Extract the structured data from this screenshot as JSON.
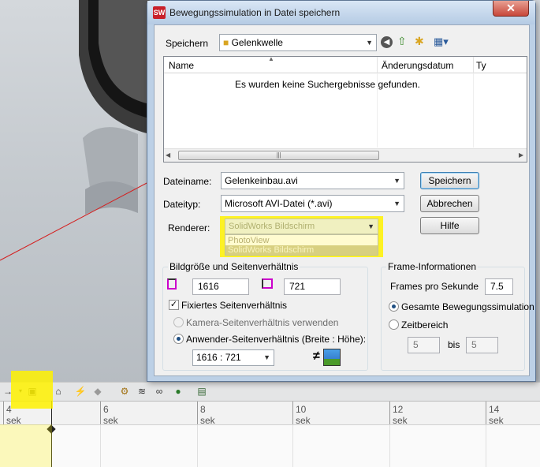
{
  "dialog": {
    "title": "Bewegungssimulation in Datei speichern",
    "app_icon": "SW",
    "close": "✕"
  },
  "location": {
    "label": "Speichern",
    "folder": "Gelenkwelle"
  },
  "file_list": {
    "columns": [
      "Name",
      "Änderungsdatum",
      "Ty"
    ],
    "empty_message": "Es wurden keine Suchergebnisse gefunden."
  },
  "fields": {
    "filename_label": "Dateiname:",
    "filename_value": "Gelenkeinbau.avi",
    "filetype_label": "Dateityp:",
    "filetype_value": "Microsoft AVI-Datei (*.avi)",
    "renderer_label": "Renderer:",
    "renderer_value": "SolidWorks Bildschirm",
    "renderer_options": [
      "PhotoView",
      "SolidWorks Bildschirm"
    ]
  },
  "buttons": {
    "save": "Speichern",
    "cancel": "Abbrechen",
    "help": "Hilfe"
  },
  "image_size": {
    "group_title": "Bildgröße und Seitenverhältnis",
    "width": "1616",
    "height": "721",
    "fixed_aspect_label": "Fixiertes Seitenverhältnis",
    "fixed_aspect_checked": true,
    "camera_aspect_label": "Kamera-Seitenverhältnis verwenden",
    "user_aspect_label": "Anwender-Seitenverhältnis (Breite : Höhe):",
    "aspect_value": "1616 : 721"
  },
  "frame_info": {
    "group_title": "Frame-Informationen",
    "fps_label": "Frames pro Sekunde",
    "fps_value": "7.5",
    "whole_label": "Gesamte Bewegungssimulation",
    "range_label": "Zeitbereich",
    "range_from": "5",
    "range_to_label": "bis",
    "range_to": "5"
  },
  "timeline": {
    "ticks": [
      "4 sek",
      "6 sek",
      "8 sek",
      "10 sek",
      "12 sek",
      "14 sek"
    ]
  },
  "colors": {
    "highlight": "#fff200",
    "dialog_frame": "#bcd0e6",
    "selection": "#3399ff"
  }
}
